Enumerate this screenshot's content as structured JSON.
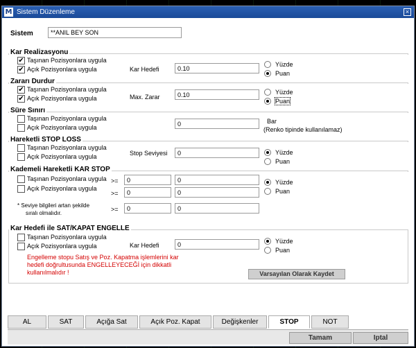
{
  "window": {
    "title": "Sistem Düzenleme",
    "app_icon": "M"
  },
  "sistem": {
    "label": "Sistem",
    "value": "**ANIL BEY SON"
  },
  "kar_realizasyonu": {
    "title": "Kar Realizasyonu",
    "checks": [
      {
        "label": "Taşınan Pozisyonlara uygula",
        "checked": true
      },
      {
        "label": "Açık Pozisyonlara uygula",
        "checked": true
      }
    ],
    "field_label": "Kar Hedefi",
    "field_value": "0.10",
    "radios": [
      {
        "label": "Yüzde",
        "selected": false
      },
      {
        "label": "Puan",
        "selected": true
      }
    ]
  },
  "zarari_durdur": {
    "title": "Zararı Durdur",
    "checks": [
      {
        "label": "Taşınan Pozisyonlara uygula",
        "checked": true
      },
      {
        "label": "Açık Pozisyonlara uygula",
        "checked": true
      }
    ],
    "field_label": "Max. Zarar",
    "field_value": "0.10",
    "radios": [
      {
        "label": "Yüzde",
        "selected": false
      },
      {
        "label": "Puan",
        "selected": true
      }
    ]
  },
  "sure_siniri": {
    "title": "Süre Sınırı",
    "checks": [
      {
        "label": "Taşınan Pozisyonlara uygula",
        "checked": false
      },
      {
        "label": "Açık Pozisyonlara uygula",
        "checked": false
      }
    ],
    "field_value": "0",
    "unit": "Bar",
    "note": "(Renko tipinde kullanılamaz)"
  },
  "hareketli_stop": {
    "title": "Hareketli STOP LOSS",
    "checks": [
      {
        "label": "Taşınan Pozisyonlara uygula",
        "checked": false
      },
      {
        "label": "Açık Pozisyonlara uygula",
        "checked": false
      }
    ],
    "field_label": "Stop Seviyesi",
    "field_value": "0",
    "radios": [
      {
        "label": "Yüzde",
        "selected": true
      },
      {
        "label": "Puan",
        "selected": false
      }
    ]
  },
  "kademeli": {
    "title": "Kademeli Hareketli KAR STOP",
    "checks": [
      {
        "label": "Taşınan Pozisyonlara uygula",
        "checked": false
      },
      {
        "label": "Açık Pozisyonlara uygula",
        "checked": false
      }
    ],
    "op": ">=",
    "rows": [
      [
        "0",
        "0"
      ],
      [
        "0",
        "0"
      ],
      [
        "0",
        "0"
      ]
    ],
    "note_line1": "* Seviye bilgileri artan şekilde",
    "note_line2": "sıralı olmalıdır.",
    "radios": [
      {
        "label": "Yüzde",
        "selected": true
      },
      {
        "label": "Puan",
        "selected": false
      }
    ]
  },
  "kar_hedefi_engelle": {
    "title": "Kar Hedefi ile SAT/KAPAT ENGELLE",
    "checks": [
      {
        "label": "Taşınan Pozisyonlara uygula",
        "checked": false
      },
      {
        "label": "Açık Pozisyonlara uygula",
        "checked": false
      }
    ],
    "field_label": "Kar Hedefi",
    "field_value": "0",
    "radios": [
      {
        "label": "Yüzde",
        "selected": true
      },
      {
        "label": "Puan",
        "selected": false
      }
    ],
    "warning_line1": "Engelleme stopu Satış ve Poz. Kapatma işlemlerini kar",
    "warning_line2": "hedefi doğrultusunda ENGELLEYECEĞİ için dikkatli",
    "warning_line3": "kullanılmalıdır !"
  },
  "default_button": "Varsayılan Olarak Kaydet",
  "tabs": [
    "AL",
    "SAT",
    "Açığa Sat",
    "Açık Poz. Kapat",
    "Değişkenler",
    "STOP",
    "NOT"
  ],
  "active_tab": "STOP",
  "ok_button": "Tamam",
  "cancel_button": "Iptal",
  "check_glyph": "✔"
}
